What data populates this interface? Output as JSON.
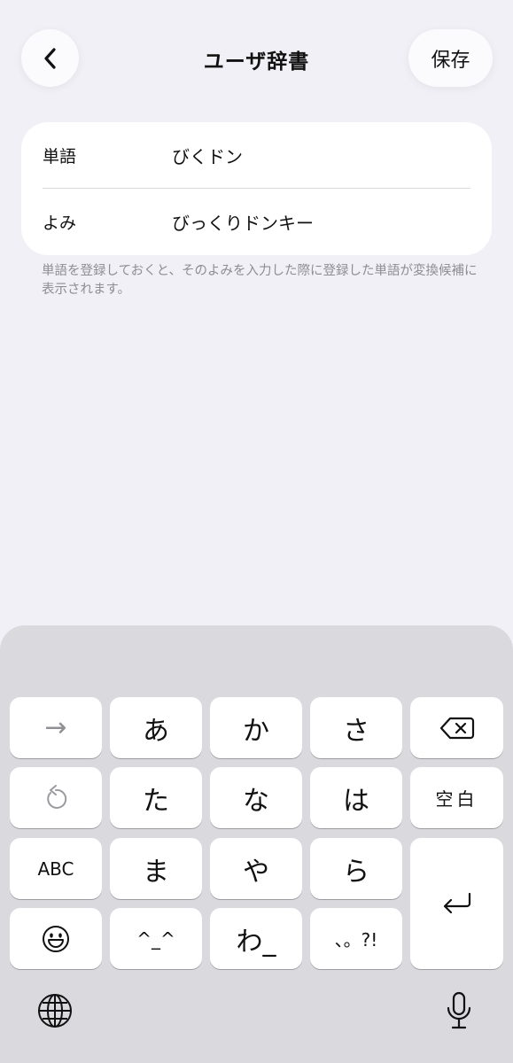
{
  "header": {
    "title": "ユーザ辞書",
    "save_label": "保存",
    "back_icon": "chevron-left-icon"
  },
  "form": {
    "word_label": "単語",
    "word_value": "びくドン",
    "reading_label": "よみ",
    "reading_value": "びっくりドンキー"
  },
  "note": "単語を登録しておくと、そのよみを入力した際に登録した単語が変換候補に表示されます。",
  "keyboard": {
    "row1": [
      "→",
      "あ",
      "か",
      "さ"
    ],
    "row2": [
      "た",
      "な",
      "は"
    ],
    "space_label": "空白",
    "row3": [
      "ABC",
      "ま",
      "や",
      "ら"
    ],
    "row4": [
      "^_^",
      "わ_",
      "、。?!"
    ],
    "icons": {
      "backspace": "backspace-icon",
      "undo": "undo-icon",
      "return": "return-icon",
      "emoji": "emoji-icon",
      "globe": "globe-icon",
      "mic": "microphone-icon"
    }
  }
}
